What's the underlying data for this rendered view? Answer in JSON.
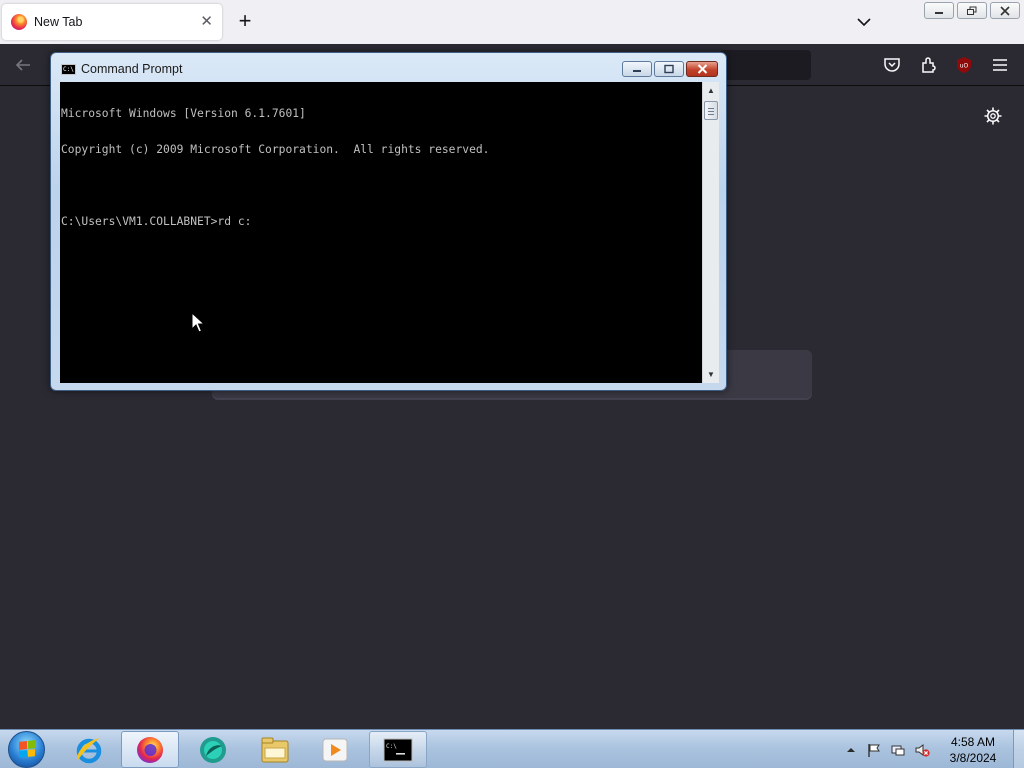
{
  "browser": {
    "tab_title": "New Tab",
    "tab_close_icon": "close-icon",
    "new_tab_label": "+"
  },
  "cmd_window": {
    "title": "Command Prompt",
    "lines": [
      "Microsoft Windows [Version 6.1.7601]",
      "Copyright (c) 2009 Microsoft Corporation.  All rights reserved.",
      "",
      "C:\\Users\\VM1.COLLABNET>rd c:"
    ]
  },
  "taskbar": {
    "pinned": [
      "internet-explorer-icon",
      "firefox-icon",
      "app-icon",
      "file-explorer-icon",
      "media-player-icon",
      "command-prompt-icon"
    ],
    "active": "firefox-icon",
    "clock": {
      "time": "4:58 AM",
      "date": "3/8/2024"
    }
  },
  "colors": {
    "page_bg": "#2b2a33",
    "tabstrip_bg": "#f0f0f4",
    "console_bg": "#000000",
    "console_fg": "#c0c0c0",
    "taskbar_bg": "#a9c2de"
  }
}
